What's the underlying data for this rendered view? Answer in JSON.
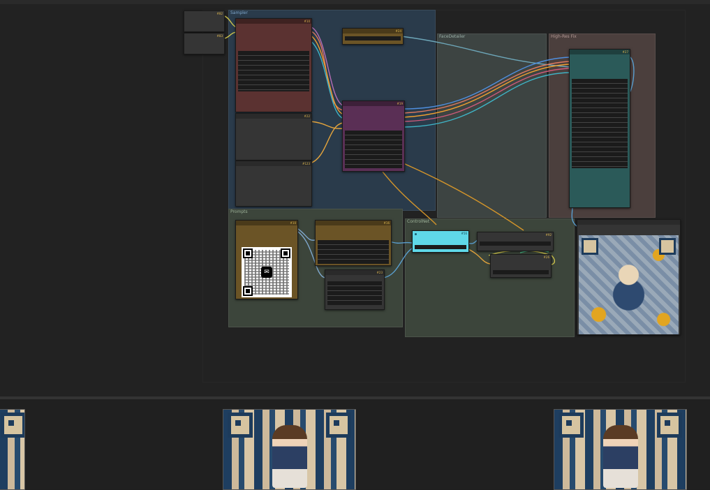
{
  "groups": {
    "sampler": "Sampler",
    "facedetailer": "FaceDetailer",
    "highres": "High-Res Fix",
    "prompts": "Prompts",
    "controlnet": "ControlNet"
  },
  "node_badges": {
    "b1": "#82",
    "b2": "#83",
    "b3": "#10",
    "b4": "#22",
    "b5": "#123",
    "b6": "#24",
    "b7": "#19",
    "b8": "#27",
    "b9": "#10",
    "b10": "#16",
    "b11": "#23",
    "b12": "#56",
    "b13": "#92",
    "b14": "#26"
  },
  "qr_icon": "wechat-icon",
  "colors": {
    "sampler_group": "#2a3b4b",
    "facedetailer_group": "#3d4442",
    "highres_group": "#4b3f3d",
    "prompts_group": "#3c453b",
    "controlnet_group": "#3c453b",
    "red_node": "#5b3231",
    "purple_node": "#5a2f55",
    "teal_node": "#2b5a59",
    "brown_node": "#6b5426",
    "cyan_node": "#5fd8e8"
  }
}
